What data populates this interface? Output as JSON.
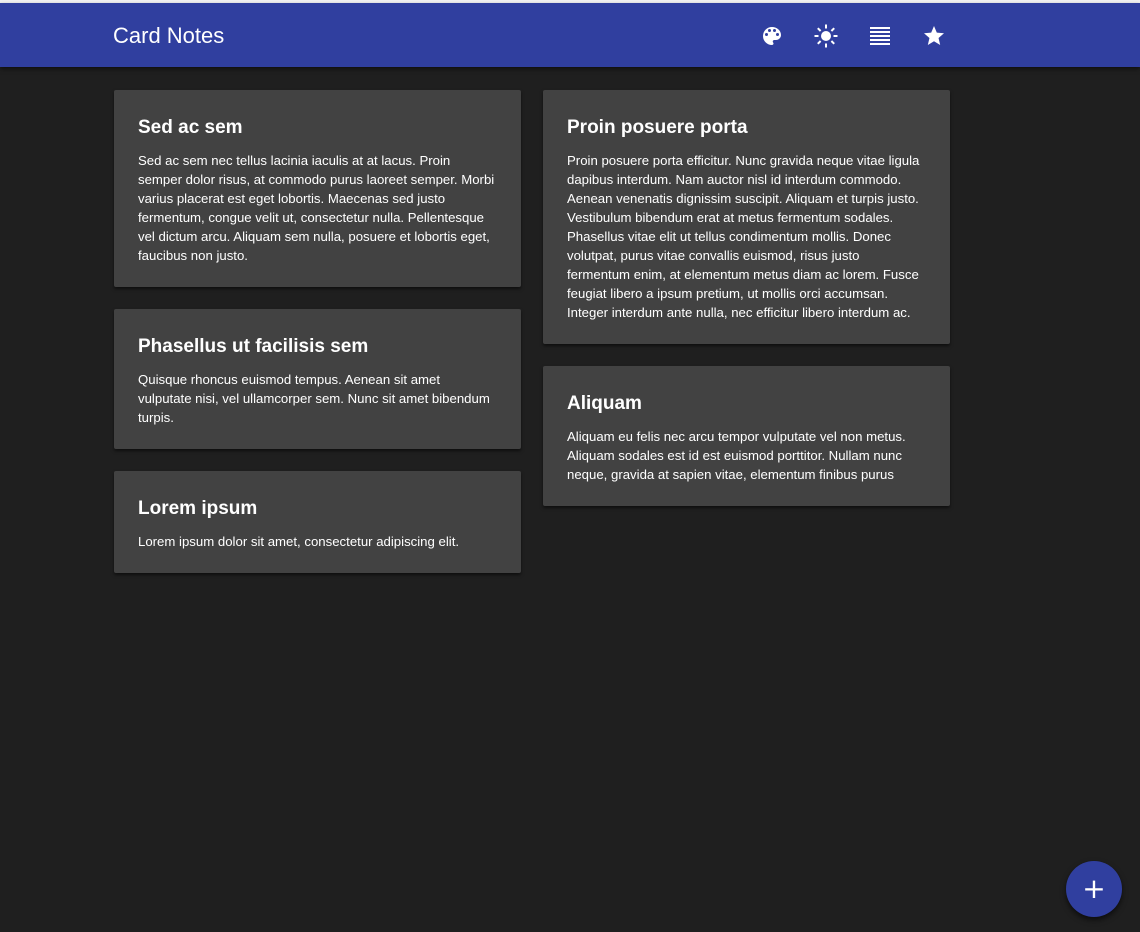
{
  "app": {
    "title": "Card Notes",
    "accent_color": "#303f9f",
    "background_color": "#1f1f1f",
    "card_color": "#424242"
  },
  "toolbar": {
    "icons": [
      "palette-icon",
      "brightness-icon",
      "list-view-icon",
      "star-icon"
    ]
  },
  "columns": {
    "left": [
      {
        "title": "Sed ac sem",
        "body": "Sed ac sem nec tellus lacinia iaculis at at lacus. Proin semper dolor risus, at commodo purus laoreet semper. Morbi varius placerat est eget lobortis. Maecenas sed justo fermentum, congue velit ut, consectetur nulla. Pellentesque vel dictum arcu. Aliquam sem nulla, posuere et lobortis eget, faucibus non justo."
      },
      {
        "title": "Phasellus ut facilisis sem",
        "body": "Quisque rhoncus euismod tempus. Aenean sit amet vulputate nisi, vel ullamcorper sem. Nunc sit amet bibendum turpis."
      },
      {
        "title": "Lorem ipsum",
        "body": "Lorem ipsum dolor sit amet, consectetur adipiscing elit."
      }
    ],
    "right": [
      {
        "title": "Proin posuere porta",
        "body": "Proin posuere porta efficitur. Nunc gravida neque vitae ligula dapibus interdum. Nam auctor nisl id interdum commodo. Aenean venenatis dignissim suscipit. Aliquam et turpis justo. Vestibulum bibendum erat at metus fermentum sodales. Phasellus vitae elit ut tellus condimentum mollis. Donec volutpat, purus vitae convallis euismod, risus justo fermentum enim, at elementum metus diam ac lorem. Fusce feugiat libero a ipsum pretium, ut mollis orci accumsan. Integer interdum ante nulla, nec efficitur libero interdum ac."
      },
      {
        "title": "Aliquam",
        "body": "Aliquam eu felis nec arcu tempor vulputate vel non metus. Aliquam sodales est id est euismod porttitor. Nullam nunc neque, gravida at sapien vitae, elementum finibus purus"
      }
    ]
  },
  "fab": {
    "label": "+",
    "icon": "add-icon"
  }
}
